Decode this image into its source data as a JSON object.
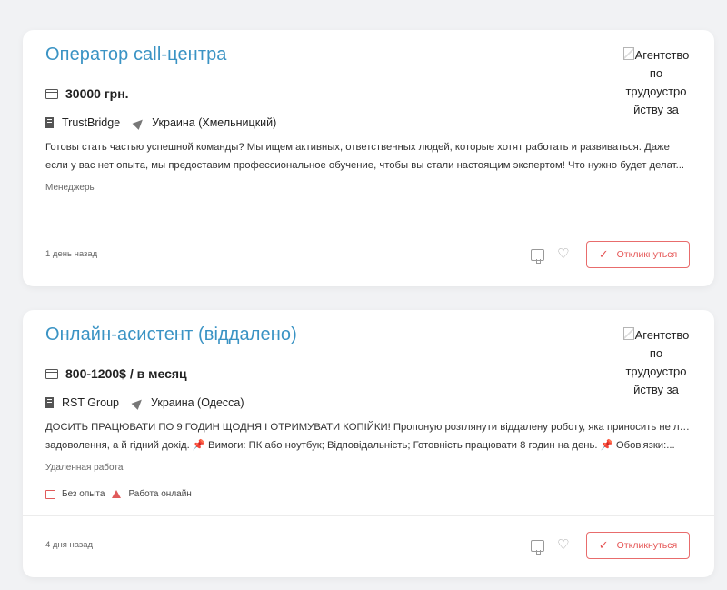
{
  "vacancies": [
    {
      "title": "Оператор call-центра",
      "logo_alt": "Агентство по трудоустро йству за",
      "salary": "30000 грн.",
      "company": "TrustBridge",
      "location": "Украина (Хмельницкий)",
      "description_lines": [
        "Готовы стать частью успешной команды? Мы ищем активных, ответственных людей, которые хотят работать и развиваться. Даже",
        "если у вас нет опыта, мы предоставим профессиональное обучение, чтобы вы стали настоящим экспертом! Что нужно будет делат..."
      ],
      "category": "Менеджеры",
      "tags": [],
      "posted": "1 день назад",
      "apply_label": "Откликнуться"
    },
    {
      "title": "Онлайн-асистент (віддалено)",
      "logo_alt": "Агентство по трудоустро йству за",
      "salary": "800-1200$ / в месяц",
      "company": "RST Group",
      "location": "Украина (Одесса)",
      "description_lines": [
        "ДОСИТЬ ПРАЦЮВАТИ ПО 9 ГОДИН ЩОДНЯ І ОТРИМУВАТИ КОПІЙКИ! Пропоную розглянути віддалену роботу, яка приносить не лише",
        "задоволення, а й гідний дохід. 📌 Вимоги: ПК або ноутбук; Відповідальність; Готовність працювати 8 годин на день. 📌 Обов'язки:..."
      ],
      "category": "Удаленная работа",
      "tags": [
        "Без опыта",
        "Работа онлайн"
      ],
      "posted": "4 дня назад",
      "apply_label": "Откликнуться"
    }
  ],
  "icons": {
    "salary": "card-icon",
    "company": "building-icon",
    "location": "navigation-arrow-icon",
    "dislike": "thumbs-down-icon",
    "favorite": "heart-icon",
    "apply": "check-icon",
    "tag_no_experience": "no-experience-icon",
    "tag_online": "home-icon"
  },
  "colors": {
    "title": "#3a93c4",
    "accent": "#e55555",
    "background": "#f1f2f4"
  }
}
